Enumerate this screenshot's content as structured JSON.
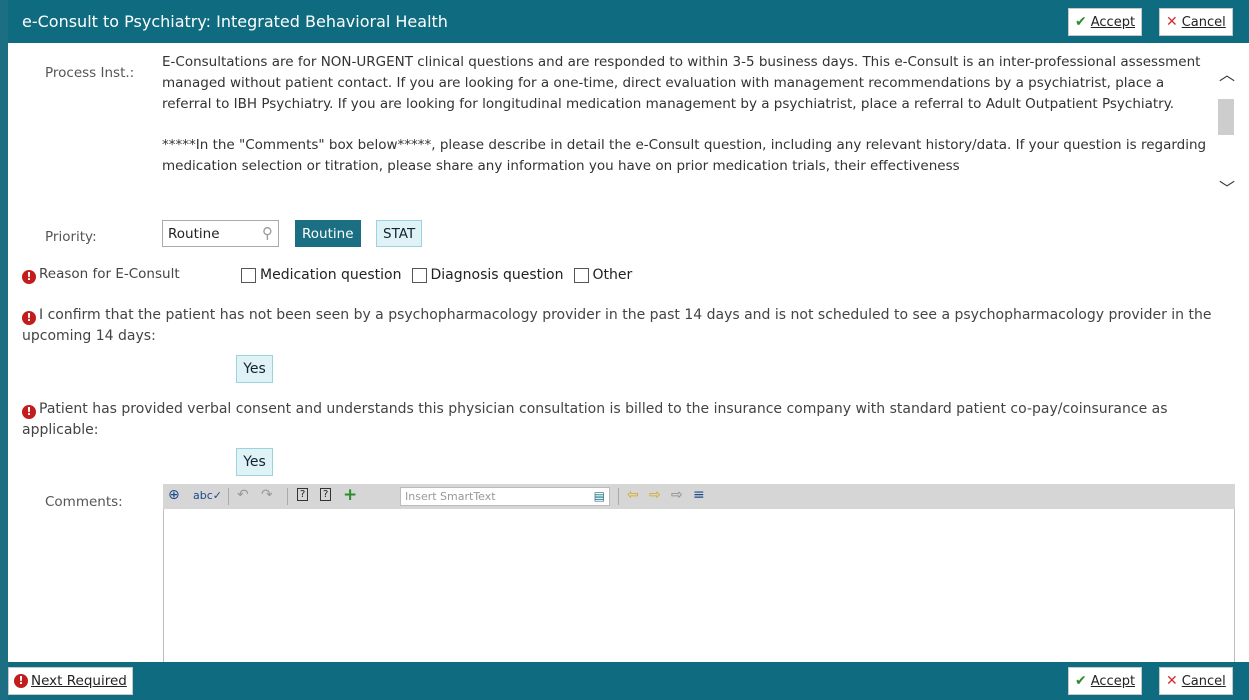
{
  "header": {
    "title": "e-Consult to Psychiatry: Integrated Behavioral Health",
    "accept_label": "Accept",
    "cancel_label": "Cancel"
  },
  "process": {
    "label": "Process Inst.:",
    "paragraph1": "E-Consultations are for NON-URGENT clinical questions and are responded to within 3-5 business days. This e-Consult is an inter-professional assessment managed without patient contact. If you are looking for a one-time, direct evaluation with management recommendations by a psychiatrist, place a referral to IBH Psychiatry. If you are looking for longitudinal medication management by a psychiatrist, place a referral to Adult Outpatient Psychiatry.",
    "paragraph2": "*****In the \"Comments\" box below*****, please describe in detail the e-Consult question, including any relevant history/data. If your question is regarding medication selection or titration, please share any information you have on prior medication trials, their effectiveness"
  },
  "priority": {
    "label": "Priority:",
    "value": "Routine",
    "options": [
      "Routine",
      "STAT"
    ]
  },
  "reason": {
    "label": "Reason for E-Consult",
    "options": [
      "Medication question",
      "Diagnosis question",
      "Other"
    ]
  },
  "confirm": {
    "text": "I confirm that the patient has not been seen by a psychopharmacology provider in the past 14 days and is not scheduled to see a psychopharmacology provider in the upcoming 14 days:",
    "answer": "Yes"
  },
  "consent": {
    "text": "Patient has provided verbal consent and understands this physician consultation is billed to the insurance company with standard patient co-pay/coinsurance as applicable:",
    "answer": "Yes"
  },
  "comments": {
    "label": "Comments:",
    "smarttext_placeholder": "Insert SmartText"
  },
  "footer": {
    "next_required_label": "Next Required",
    "accept_label": "Accept",
    "cancel_label": "Cancel"
  },
  "colors": {
    "header_bg": "#0f6b80",
    "toggle_on": "#1a6f83",
    "toggle_off": "#dff3f7",
    "required": "#c21c1c"
  }
}
